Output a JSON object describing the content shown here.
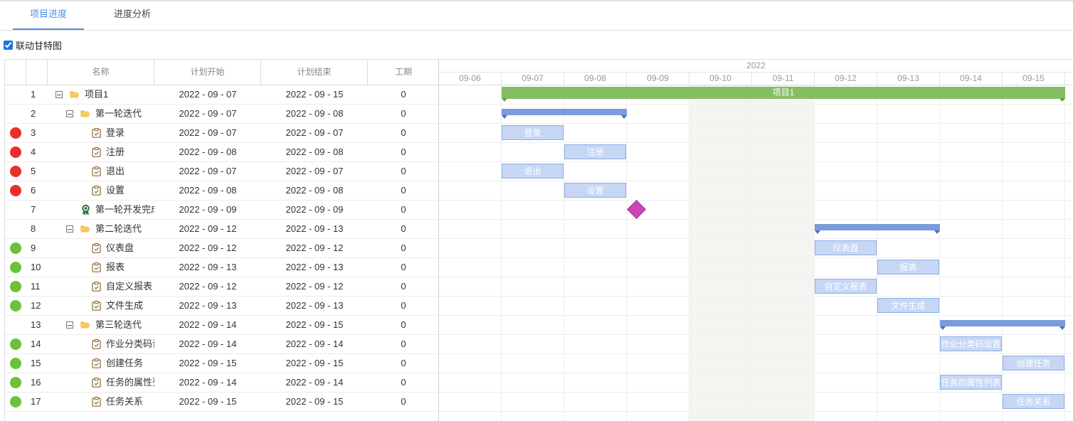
{
  "tabs": [
    {
      "label": "项目进度",
      "active": true
    },
    {
      "label": "进度分析",
      "active": false
    }
  ],
  "link_gantt": {
    "label": "联动甘特图",
    "checked": true
  },
  "columns": {
    "name": "名称",
    "start": "计划开始",
    "end": "计划结束",
    "duration": "工期"
  },
  "timeline": {
    "year": "2022",
    "days": [
      "09-06",
      "09-07",
      "09-08",
      "09-09",
      "09-10",
      "09-11",
      "09-12",
      "09-13",
      "09-14",
      "09-15"
    ],
    "weekend_days": [
      "09-10",
      "09-11"
    ]
  },
  "colors": {
    "accent": "#4a90d9",
    "status_red": "#e8302a",
    "status_green": "#6cc138",
    "project_bar": "#85bd61",
    "summary_bar": "#7a9bdc",
    "task_bar": "#c6d7f5",
    "milestone": "#cc45b4"
  },
  "rows": [
    {
      "no": "1",
      "name": "项目1",
      "start": "2022 - 09 - 07",
      "end": "2022 - 09 - 15",
      "duration": "0",
      "type": "project",
      "level": 0,
      "status": "",
      "icon": "folder-open-icon"
    },
    {
      "no": "2",
      "name": "第一轮迭代",
      "start": "2022 - 09 - 07",
      "end": "2022 - 09 - 08",
      "duration": "0",
      "type": "summary",
      "level": 1,
      "status": "",
      "icon": "folder-open-icon"
    },
    {
      "no": "3",
      "name": "登录",
      "start": "2022 - 09 - 07",
      "end": "2022 - 09 - 07",
      "duration": "0",
      "type": "task",
      "level": 2,
      "status": "red",
      "icon": "task-clipboard-icon"
    },
    {
      "no": "4",
      "name": "注册",
      "start": "2022 - 09 - 08",
      "end": "2022 - 09 - 08",
      "duration": "0",
      "type": "task",
      "level": 2,
      "status": "red",
      "icon": "task-clipboard-icon"
    },
    {
      "no": "5",
      "name": "退出",
      "start": "2022 - 09 - 07",
      "end": "2022 - 09 - 07",
      "duration": "0",
      "type": "task",
      "level": 2,
      "status": "red",
      "icon": "task-clipboard-icon"
    },
    {
      "no": "6",
      "name": "设置",
      "start": "2022 - 09 - 08",
      "end": "2022 - 09 - 08",
      "duration": "0",
      "type": "task",
      "level": 2,
      "status": "red",
      "icon": "task-clipboard-icon"
    },
    {
      "no": "7",
      "name": "第一轮开发完成",
      "start": "2022 - 09 - 09",
      "end": "2022 - 09 - 09",
      "duration": "0",
      "type": "milestone",
      "level": 1,
      "status": "",
      "icon": "milestone-award-icon"
    },
    {
      "no": "8",
      "name": "第二轮迭代",
      "start": "2022 - 09 - 12",
      "end": "2022 - 09 - 13",
      "duration": "0",
      "type": "summary",
      "level": 1,
      "status": "",
      "icon": "folder-open-icon"
    },
    {
      "no": "9",
      "name": "仪表盘",
      "start": "2022 - 09 - 12",
      "end": "2022 - 09 - 12",
      "duration": "0",
      "type": "task",
      "level": 2,
      "status": "green",
      "icon": "task-clipboard-icon"
    },
    {
      "no": "10",
      "name": "报表",
      "start": "2022 - 09 - 13",
      "end": "2022 - 09 - 13",
      "duration": "0",
      "type": "task",
      "level": 2,
      "status": "green",
      "icon": "task-clipboard-icon"
    },
    {
      "no": "11",
      "name": "自定义报表",
      "start": "2022 - 09 - 12",
      "end": "2022 - 09 - 12",
      "duration": "0",
      "type": "task",
      "level": 2,
      "status": "green",
      "icon": "task-clipboard-icon"
    },
    {
      "no": "12",
      "name": "文件生成",
      "start": "2022 - 09 - 13",
      "end": "2022 - 09 - 13",
      "duration": "0",
      "type": "task",
      "level": 2,
      "status": "green",
      "icon": "task-clipboard-icon"
    },
    {
      "no": "13",
      "name": "第三轮迭代",
      "start": "2022 - 09 - 14",
      "end": "2022 - 09 - 15",
      "duration": "0",
      "type": "summary",
      "level": 1,
      "status": "",
      "icon": "folder-open-icon"
    },
    {
      "no": "14",
      "name": "作业分类码设置",
      "start": "2022 - 09 - 14",
      "end": "2022 - 09 - 14",
      "duration": "0",
      "type": "task",
      "level": 2,
      "status": "green",
      "icon": "task-clipboard-icon"
    },
    {
      "no": "15",
      "name": "创建任务",
      "start": "2022 - 09 - 15",
      "end": "2022 - 09 - 15",
      "duration": "0",
      "type": "task",
      "level": 2,
      "status": "green",
      "icon": "task-clipboard-icon"
    },
    {
      "no": "16",
      "name": "任务的属性列表",
      "start": "2022 - 09 - 14",
      "end": "2022 - 09 - 14",
      "duration": "0",
      "type": "task",
      "level": 2,
      "status": "green",
      "icon": "task-clipboard-icon"
    },
    {
      "no": "17",
      "name": "任务关系",
      "start": "2022 - 09 - 15",
      "end": "2022 - 09 - 15",
      "duration": "0",
      "type": "task",
      "level": 2,
      "status": "green",
      "icon": "task-clipboard-icon"
    }
  ]
}
